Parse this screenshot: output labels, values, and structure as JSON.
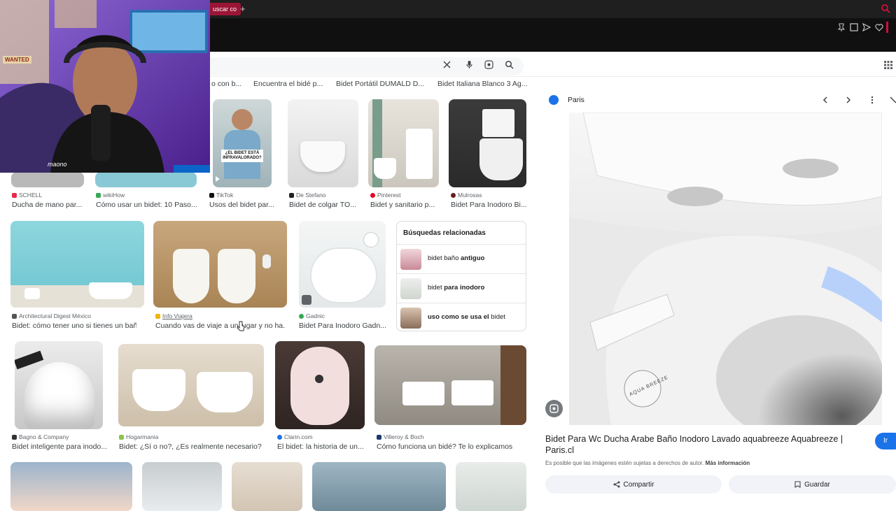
{
  "browser": {
    "tab_label": "uscar co",
    "new_tab": "+"
  },
  "results": {
    "top_captions": [
      "o con b...",
      "Encuentra el bidé p...",
      "Bidet Portátil DUMALD D...",
      "Bidet Italiana Blanco 3 Ag..."
    ],
    "row1": [
      {
        "source": "SCHELL",
        "caption": "Ducha de mano par...",
        "color": "#e8294a"
      },
      {
        "source": "wikiHow",
        "caption": "Cómo usar un bidet: 10 Paso...",
        "color": "#3aa757"
      },
      {
        "source": "TikTok",
        "caption": "Usos del bidet par...",
        "color": "#111111"
      },
      {
        "source": "De Stefano",
        "caption": "Bidet de colgar TO...",
        "color": "#222222"
      },
      {
        "source": "Pinterest",
        "caption": "Bidet y sanitario p...",
        "color": "#e60023"
      },
      {
        "source": "Mulrosas",
        "caption": "Bidet Para Inodoro Bi...",
        "color": "#6b1d1d"
      }
    ],
    "tiktok_thumb_text": "¿EL BIDET ESTÁ INFRAVALORADO?",
    "row2": [
      {
        "source": "Architectural Digest México",
        "caption": "Bidet: cómo tener uno si tienes un bañ...",
        "color": "#555555"
      },
      {
        "source": "Info Viajera",
        "caption": "Cuando vas de viaje a un lugar y no ha...",
        "color": "#f4b400"
      },
      {
        "source": "Gadnic",
        "caption": "Bidet Para Inodoro Gadn...",
        "color": "#34a853"
      }
    ],
    "row3": [
      {
        "source": "Bagno & Company",
        "caption": "Bidet inteligente para inodo...",
        "color": "#333333"
      },
      {
        "source": "Hogarmania",
        "caption": "Bidet: ¿Sí o no?, ¿Es realmente necesario?",
        "color": "#8bc34a"
      },
      {
        "source": "Clarin.com",
        "caption": "El bidet: la historia de un...",
        "color": "#1a73e8"
      },
      {
        "source": "Villeroy & Boch",
        "caption": "Cómo funciona un bidé? Te lo explicamos",
        "color": "#1b3a6b"
      }
    ]
  },
  "related": {
    "title": "Búsquedas relacionadas",
    "items": [
      {
        "plain": "bidet baño",
        "bold": "antiguo"
      },
      {
        "plain": "bidet",
        "bold": "para inodoro"
      },
      {
        "bold": "uso como se usa el",
        "plain": "bidet"
      }
    ]
  },
  "panel": {
    "site": "Paris",
    "title": "Bidet Para Wc Ducha Arabe Baño Inodoro Lavado aquabreeze Aquabreeze | Paris.cl",
    "copyright_note": "Es posible que las imágenes estén sujetas a derechos de autor.",
    "more_info": "Más información",
    "go_button": "Ir",
    "share_button": "Compartir",
    "save_button": "Guardar",
    "product_text": "AQUA BREEZE"
  },
  "webcam": {
    "overlay_text": "maono",
    "poster_text": "WANTED"
  }
}
